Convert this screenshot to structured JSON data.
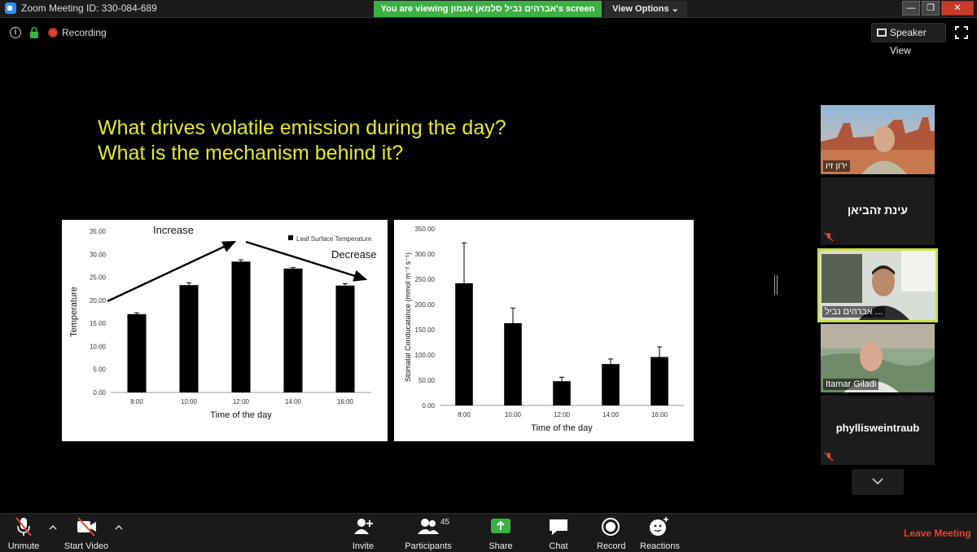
{
  "window": {
    "title": "Zoom Meeting ID: 330-084-689",
    "viewing_banner": "You are viewing אברהים נביל סלמאן אגמון's screen",
    "view_options": "View Options ⌄",
    "min": "—",
    "max": "❐",
    "close": "✕"
  },
  "top": {
    "info": "i",
    "recording": "Recording",
    "speaker_view": "Speaker View"
  },
  "slide": {
    "title_line1": "What drives volatile emission during the day?",
    "title_line2": "What is the mechanism behind it?"
  },
  "chart_data": [
    {
      "type": "bar",
      "categories": [
        "8:00",
        "10:00",
        "12:00",
        "14:00",
        "16:00"
      ],
      "series": [
        {
          "name": "Leaf Surface Temperature",
          "values": [
            17.0,
            23.3,
            28.4,
            26.9,
            23.2
          ],
          "errors": [
            0.3,
            0.5,
            0.4,
            0.2,
            0.4
          ]
        }
      ],
      "yticks": [
        "0.00",
        "5.00",
        "10.00",
        "15.00",
        "20.00",
        "25.00",
        "30.00",
        "35.00"
      ],
      "ylim": [
        0,
        35
      ],
      "xlabel": "Time of the day",
      "ylabel": "Temperature",
      "legend": "top-right",
      "annotations": [
        "Increase",
        "Decrease"
      ]
    },
    {
      "type": "bar",
      "categories": [
        "8:00",
        "10:00",
        "12:00",
        "14:00",
        "16:00"
      ],
      "series": [
        {
          "values": [
            242,
            163,
            48,
            82,
            96
          ],
          "errors": [
            80,
            30,
            8,
            10,
            20
          ]
        }
      ],
      "yticks": [
        "0.00",
        "50.00",
        "100.00",
        "150.00",
        "200.00",
        "250.00",
        "300.00",
        "350.00"
      ],
      "ylim": [
        0,
        350
      ],
      "xlabel": "Time of the day",
      "ylabel": "Stomatal Conducatance (mmol m⁻² s⁻¹)"
    }
  ],
  "participants": [
    {
      "name": "ירון זיו",
      "video": true
    },
    {
      "name": "עינת זהביאן",
      "video": false,
      "muted": true
    },
    {
      "name": "אברהים נביל ...",
      "video": true,
      "active": true
    },
    {
      "name": "Itamar Giladi",
      "video": true
    },
    {
      "name": "phyllisweintraub",
      "video": false,
      "muted": true
    }
  ],
  "toolbar": {
    "unmute": "Unmute",
    "start_video": "Start Video",
    "invite": "Invite",
    "participants": "Participants",
    "participants_count": "45",
    "share_screen": "Share Screen",
    "chat": "Chat",
    "record": "Record",
    "reactions": "Reactions",
    "leave": "Leave Meeting"
  },
  "colors": {
    "accent_green": "#3cb043",
    "leave_red": "#e8442e",
    "slide_title_yellow": "#e8e82a",
    "active_border": "#c9e04a"
  }
}
